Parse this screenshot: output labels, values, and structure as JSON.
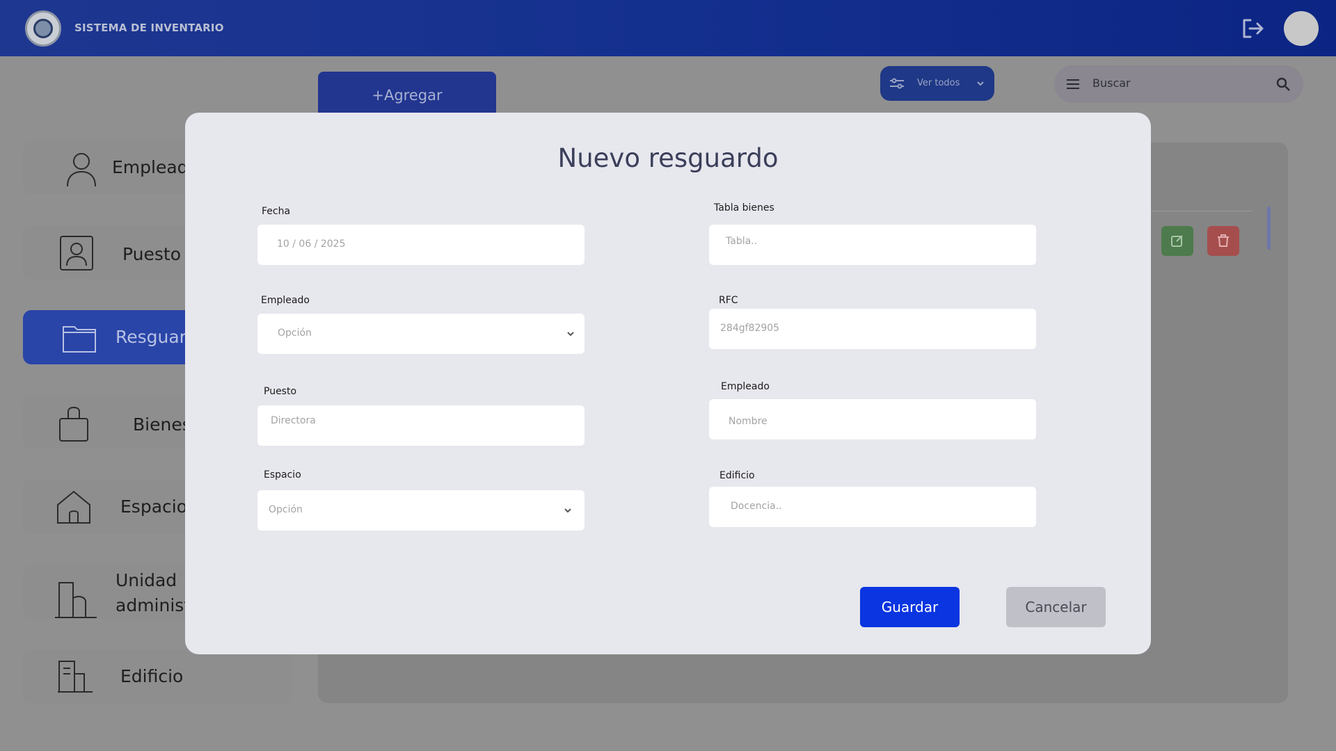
{
  "header": {
    "app_title": "SISTEMA DE INVENTARIO",
    "logo_icon": "emblem-icon",
    "logout_icon": "logout-icon"
  },
  "toolbar": {
    "add_label": "+Agregar",
    "filter_label": "Ver todos",
    "search_placeholder": "Buscar"
  },
  "sidebar": {
    "items": [
      {
        "label": "Empleado",
        "icon": "person-icon"
      },
      {
        "label": "Puesto",
        "icon": "badge-icon"
      },
      {
        "label": "Resguardo",
        "icon": "folder-icon",
        "active": true
      },
      {
        "label": "Bienes",
        "icon": "briefcase-icon"
      },
      {
        "label": "Espacio",
        "icon": "house-icon"
      },
      {
        "label": "Unidad administrativa",
        "label_line1": "Unidad",
        "label_line2": "administrativa",
        "icon": "buildings-icon"
      },
      {
        "label": "Edificio",
        "icon": "building-icon"
      }
    ]
  },
  "modal": {
    "title": "Nuevo resguardo",
    "left": {
      "fecha": {
        "label": "Fecha",
        "value": "10 / 06 / 2025"
      },
      "empleado": {
        "label": "Empleado",
        "placeholder": "Opción"
      },
      "puesto": {
        "label": "Puesto",
        "placeholder": "Directora"
      },
      "espacio": {
        "label": "Espacio",
        "placeholder": "Opción"
      }
    },
    "right": {
      "tabla_bienes": {
        "label": "Tabla bienes",
        "placeholder": "Tabla.."
      },
      "rfc": {
        "label": "RFC",
        "placeholder": "284gf82905"
      },
      "empleado": {
        "label": "Empleado",
        "placeholder": "Nombre"
      },
      "edificio": {
        "label": "Edificio",
        "placeholder": "Docencia.."
      }
    },
    "save_label": "Guardar",
    "cancel_label": "Cancelar"
  },
  "colors": {
    "header": "#14308f",
    "primary_button": "#0a35e0",
    "active_sidebar": "#2a45a8"
  }
}
